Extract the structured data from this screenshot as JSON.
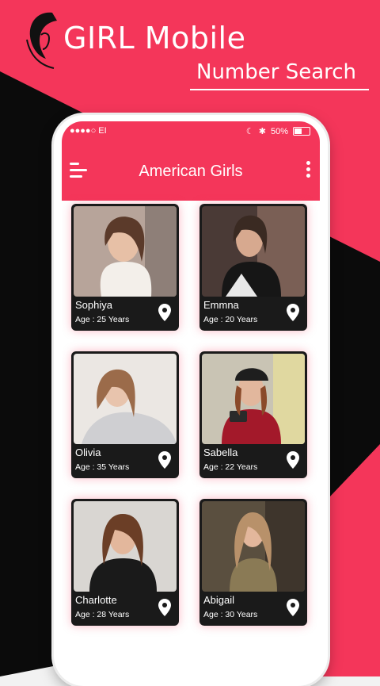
{
  "brand": {
    "title": "GIRL Mobile",
    "subtitle": "Number Search"
  },
  "status_bar": {
    "carrier": "●●●●○ EI",
    "battery": "50%"
  },
  "app_bar": {
    "title": "American Girls"
  },
  "profiles": [
    {
      "name": "Sophiya",
      "age": "Age : 25 Years"
    },
    {
      "name": "Emmna",
      "age": "Age : 20 Years"
    },
    {
      "name": "Olivia",
      "age": "Age : 35 Years"
    },
    {
      "name": "Sabella",
      "age": "Age : 22 Years"
    },
    {
      "name": "Charlotte",
      "age": "Age : 28 Years"
    },
    {
      "name": "Abigail",
      "age": "Age : 30 Years"
    }
  ],
  "colors": {
    "accent": "#f4365a",
    "dark": "#0b0b0b",
    "card": "#1a1a1a"
  }
}
